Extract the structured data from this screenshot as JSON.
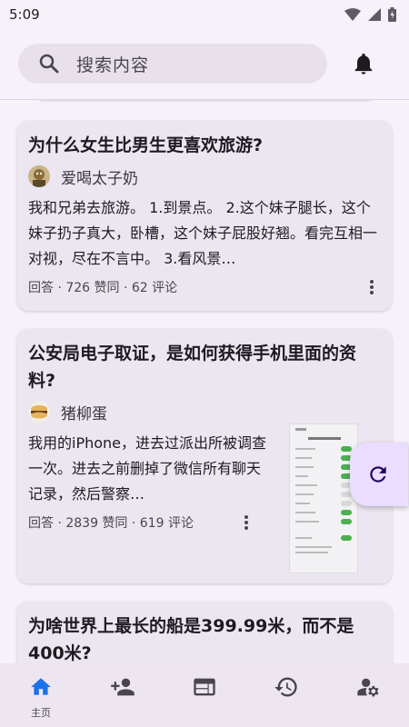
{
  "status_bar": {
    "time": "5:09"
  },
  "search": {
    "placeholder": "搜索内容"
  },
  "feed": [
    {
      "title": "为什么女生比男生更喜欢旅游?",
      "author": "爱喝太子奶",
      "excerpt": "我和兄弟去旅游。 1.到景点。 2.这个妹子腿长，这个妹子扔子真大，卧槽，这个妹子屁股好翘。看完互相一对视，尽在不言中。 3.看风景…",
      "meta": "回答 · 726 赞同 · 62 评论"
    },
    {
      "title": "公安局电子取证，是如何获得手机里面的资料?",
      "author": "猪柳蛋",
      "excerpt": "我用的iPhone，进去过派出所被调查一次。进去之前删掉了微信所有聊天记录，然后警察…",
      "meta": "回答 · 2839 赞同 · 619 评论"
    },
    {
      "title": "为啥世界上最长的船是399.99米，而不是400米?"
    }
  ],
  "bottom_nav": {
    "items": [
      {
        "icon": "home-icon",
        "label": "主页",
        "active": true
      },
      {
        "icon": "person-add-icon"
      },
      {
        "icon": "web-icon"
      },
      {
        "icon": "history-icon"
      },
      {
        "icon": "manage-accounts-icon"
      }
    ]
  },
  "colors": {
    "accent": "#1a73e8",
    "fab": "#eaddff",
    "card": "#ece6f0"
  }
}
